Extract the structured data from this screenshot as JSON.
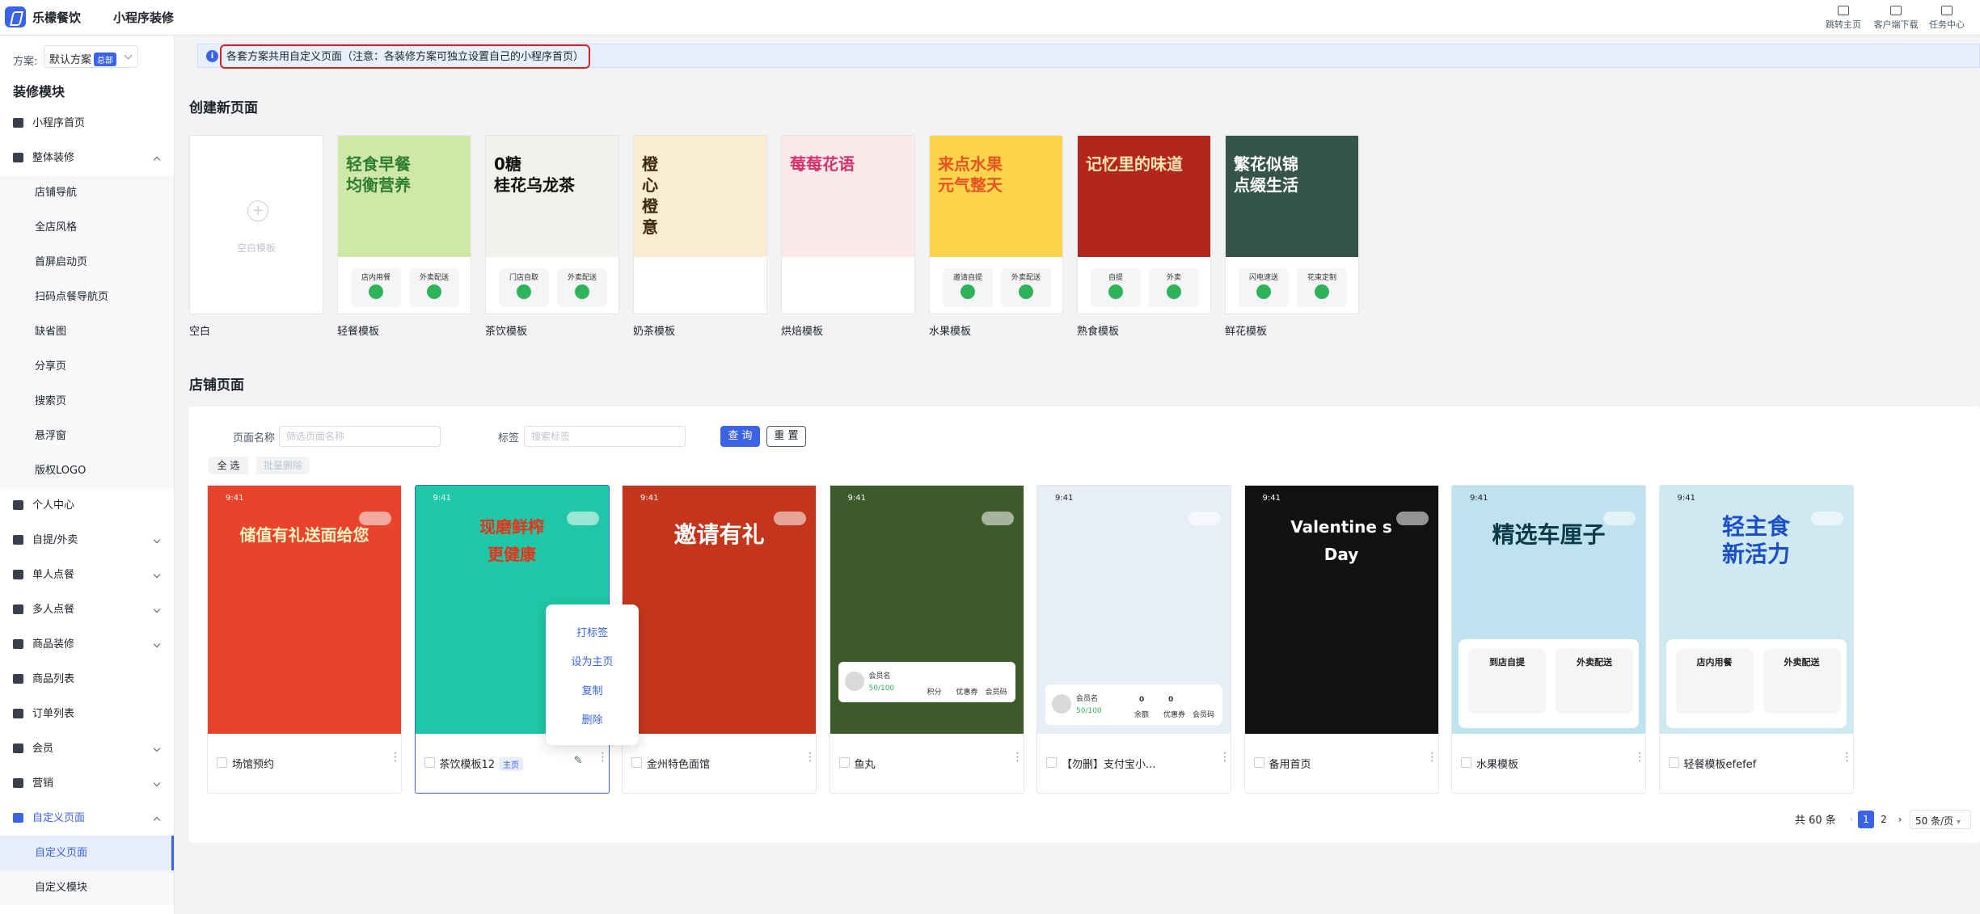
{
  "header": {
    "brand": "乐檬餐饮",
    "app_title": "小程序装修",
    "nav": [
      {
        "label": "跳转主页",
        "icon": "home-icon"
      },
      {
        "label": "客户端下载",
        "icon": "folder-icon"
      },
      {
        "label": "任务中心",
        "icon": "clipboard-icon"
      }
    ]
  },
  "sidebar": {
    "scheme_label": "方案:",
    "scheme_value": "默认方案",
    "scheme_tag": "总部",
    "title": "装修模块",
    "items": [
      {
        "label": "小程序首页",
        "type": "top",
        "icon": "home-icon"
      },
      {
        "label": "整体装修",
        "type": "parent-open",
        "icon": "shirt-icon"
      },
      {
        "label": "店铺导航",
        "type": "sub"
      },
      {
        "label": "全店风格",
        "type": "sub"
      },
      {
        "label": "首屏启动页",
        "type": "sub"
      },
      {
        "label": "扫码点餐导航页",
        "type": "sub"
      },
      {
        "label": "缺省图",
        "type": "sub"
      },
      {
        "label": "分享页",
        "type": "sub"
      },
      {
        "label": "搜索页",
        "type": "sub"
      },
      {
        "label": "悬浮窗",
        "type": "sub"
      },
      {
        "label": "版权LOGO",
        "type": "sub"
      },
      {
        "label": "个人中心",
        "type": "top",
        "icon": "user-icon"
      },
      {
        "label": "自提/外卖",
        "type": "parent",
        "icon": "bag-icon"
      },
      {
        "label": "单人点餐",
        "type": "parent",
        "icon": "bowl-icon"
      },
      {
        "label": "多人点餐",
        "type": "parent",
        "icon": "dish-icon"
      },
      {
        "label": "商品装修",
        "type": "parent",
        "icon": "goods-icon"
      },
      {
        "label": "商品列表",
        "type": "top",
        "icon": "list-icon"
      },
      {
        "label": "订单列表",
        "type": "top",
        "icon": "order-icon"
      },
      {
        "label": "会员",
        "type": "parent",
        "icon": "diamond-icon"
      },
      {
        "label": "营销",
        "type": "parent",
        "icon": "gift-icon"
      },
      {
        "label": "自定义页面",
        "type": "parent-open-active",
        "icon": "custom-page-icon"
      },
      {
        "label": "自定义页面",
        "type": "sub-active"
      },
      {
        "label": "自定义模块",
        "type": "sub"
      }
    ]
  },
  "notice": {
    "text": "各套方案共用自定义页面（注意：各装修方案可独立设置自己的小程序首页）"
  },
  "create_section": {
    "title": "创建新页面",
    "blank_text": "空白模板",
    "templates": [
      {
        "label": "空白",
        "hero": "",
        "bg": "#ffffff"
      },
      {
        "label": "轻餐模板",
        "hero": "轻食早餐\n均衡营养",
        "bg": "#cfe8a8",
        "color": "#2e7d32",
        "chips": [
          "店内用餐",
          "外卖配送"
        ]
      },
      {
        "label": "茶饮模板",
        "hero": "0糖\n桂花乌龙茶",
        "bg": "#f2f1ec",
        "color": "#111111",
        "chips": [
          "门店自取",
          "外卖配送"
        ]
      },
      {
        "label": "奶茶模板",
        "hero": "橙\n心\n橙\n意",
        "bg": "#f9ecd2",
        "color": "#3a2a10",
        "chips": []
      },
      {
        "label": "烘焙模板",
        "hero": "莓莓花语",
        "bg": "#fbe8ea",
        "color": "#d6336c",
        "chips": []
      },
      {
        "label": "水果模板",
        "hero": "来点水果\n元气整天",
        "bg": "#ffd44d",
        "color": "#e8531f",
        "chips": [
          "邀请自提",
          "外卖配送"
        ]
      },
      {
        "label": "熟食模板",
        "hero": "记忆里的味道",
        "bg": "#b3261e",
        "color": "#ffe5b4",
        "chips": [
          "自提",
          "外卖"
        ]
      },
      {
        "label": "鲜花模板",
        "hero": "繁花似锦\n点缀生活",
        "bg": "#35544a",
        "color": "#ffffff",
        "chips": [
          "闪电速送",
          "花束定制"
        ]
      }
    ]
  },
  "store_section": {
    "title": "店铺页面",
    "filters": {
      "name_label": "页面名称",
      "name_placeholder": "筛选页面名称",
      "tag_label": "标签",
      "tag_placeholder": "搜索标签",
      "query_btn": "查 询",
      "reset_btn": "重 置",
      "select_all": "全 选",
      "batch_delete": "批量删除"
    },
    "pages": [
      {
        "name": "场馆预约",
        "time": "9:41",
        "hero": "储值有礼送面给您",
        "bg": "#e9442b",
        "hero_color": "#fff4c2",
        "is_home": false
      },
      {
        "name": "茶饮模板12",
        "time": "9:41",
        "hero": "现磨鲜榨\n更健康",
        "bg": "#1ec7a5",
        "hero_color": "#e8331b",
        "is_home": true,
        "home_tag": "主页"
      },
      {
        "name": "金州特色面馆",
        "time": "9:41",
        "hero": "邀请有礼",
        "bg": "#c3361c",
        "hero_color": "#ffffff",
        "is_home": false
      },
      {
        "name": "鱼丸",
        "time": "9:41",
        "hero": "",
        "bg": "#3d5a2a",
        "hero_color": "#ffffff",
        "is_home": false,
        "member": {
          "name": "会员名",
          "progress": "50/100",
          "cols": [
            "积分",
            "优惠券",
            "会员码"
          ]
        }
      },
      {
        "name": "【勿删】支付宝小...",
        "time": "9:41",
        "hero": "",
        "bg": "#e8eef5",
        "hero_color": "#ffffff",
        "is_home": false,
        "member": {
          "name": "会员名",
          "progress": "50/100",
          "cols": [
            "余额",
            "优惠券",
            "会员码"
          ],
          "values": [
            "0",
            "0",
            ""
          ]
        }
      },
      {
        "name": "备用首页",
        "time": "9:41",
        "hero": "Valentine s\nDay",
        "bg": "#111111",
        "hero_color": "#ffffff",
        "is_home": false
      },
      {
        "name": "水果模板",
        "time": "9:41",
        "hero": "精选车厘子",
        "bg": "#bfe3ee",
        "hero_color": "#0d3a4a",
        "is_home": false,
        "chips": [
          "到店自提",
          "外卖配送"
        ]
      },
      {
        "name": "轻餐模板efefef",
        "time": "9:41",
        "hero": "轻主食\n新活力",
        "bg": "#cfe9f3",
        "hero_color": "#1b4fc7",
        "is_home": false,
        "chips": [
          "店内用餐",
          "外卖配送"
        ]
      }
    ],
    "context_menu": [
      "打标签",
      "设为主页",
      "复制",
      "删除"
    ],
    "pagination": {
      "total": "共 60 条",
      "pages": [
        "1",
        "2"
      ],
      "current": "1",
      "page_size": "50 条/页"
    }
  },
  "colors": {
    "primary": "#3b63e6",
    "notice_border": "#e02020"
  }
}
